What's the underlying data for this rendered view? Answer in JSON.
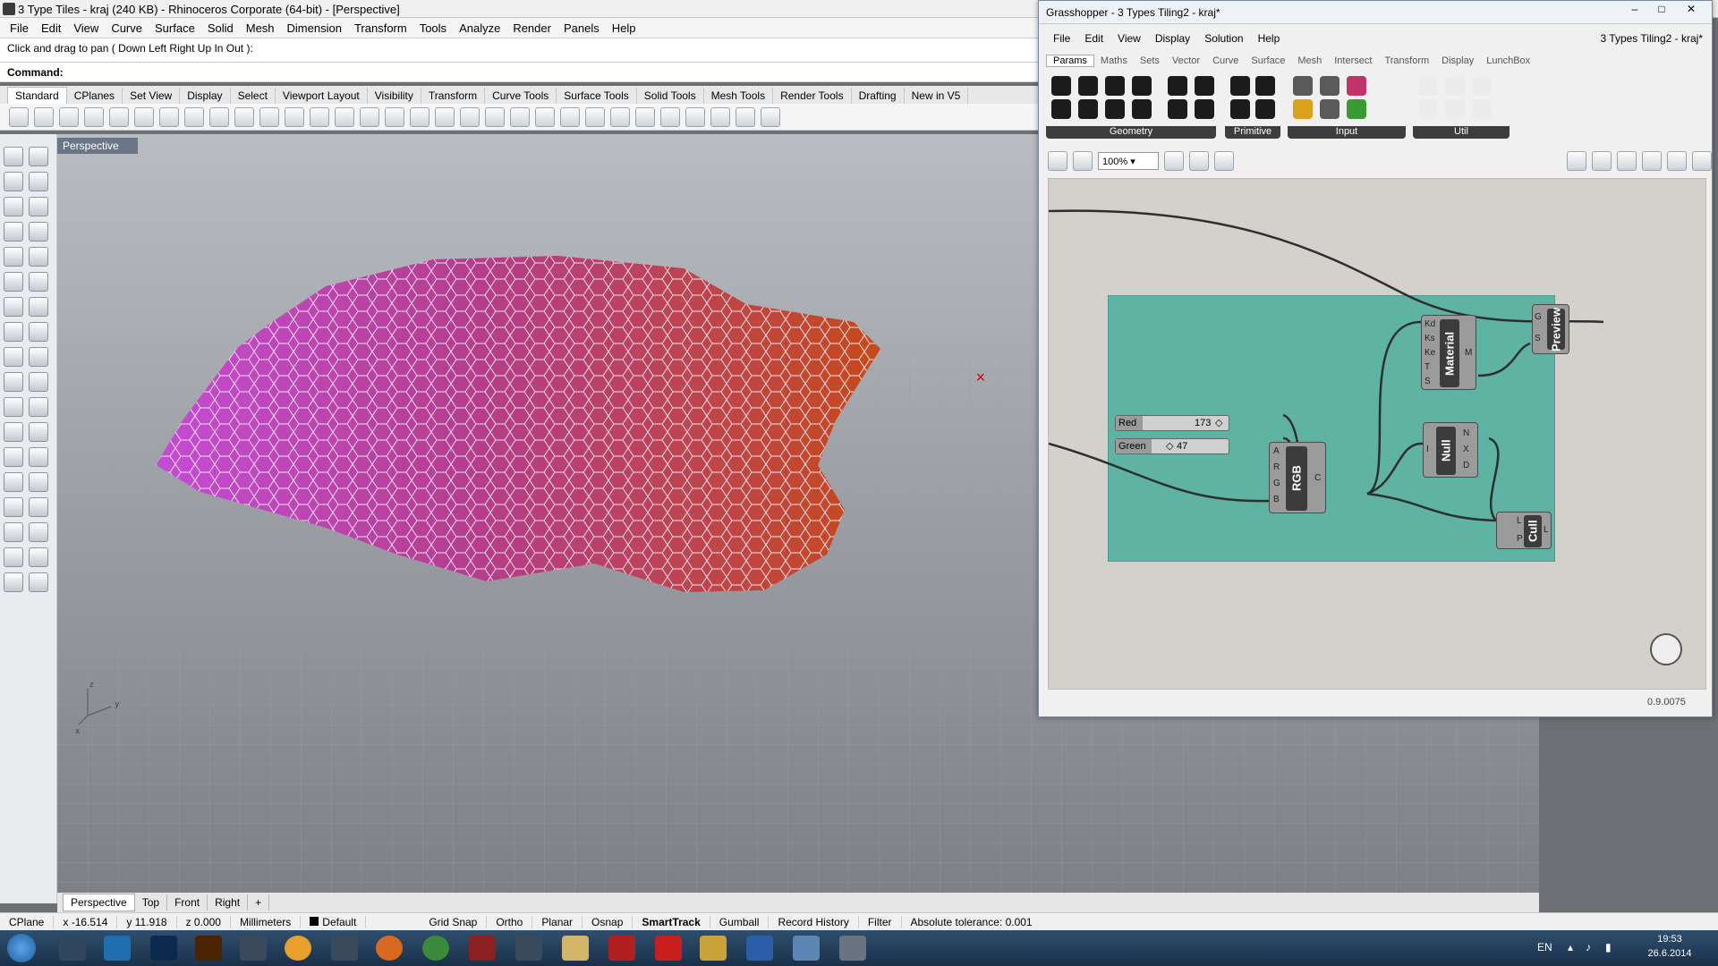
{
  "rhino": {
    "title": "3 Type Tiles - kraj (240 KB) - Rhinoceros Corporate (64-bit) - [Perspective]",
    "menu": [
      "File",
      "Edit",
      "View",
      "Curve",
      "Surface",
      "Solid",
      "Mesh",
      "Dimension",
      "Transform",
      "Tools",
      "Analyze",
      "Render",
      "Panels",
      "Help"
    ],
    "command_history": "Click and drag to pan ( Down  Left  Right  Up  In  Out ):",
    "command_prompt": "Command:",
    "toolbar_tabs": [
      "Standard",
      "CPlanes",
      "Set View",
      "Display",
      "Select",
      "Viewport Layout",
      "Visibility",
      "Transform",
      "Curve Tools",
      "Surface Tools",
      "Solid Tools",
      "Mesh Tools",
      "Render Tools",
      "Drafting",
      "New in V5"
    ],
    "viewport_title": "Perspective",
    "viewport_tabs": [
      "Perspective",
      "Top",
      "Front",
      "Right"
    ],
    "status": {
      "cplane": "CPlane",
      "x": "x -16.514",
      "y": "y 11.918",
      "z": "z 0.000",
      "units": "Millimeters",
      "layer": "Default",
      "grid_snap": "Grid Snap",
      "ortho": "Ortho",
      "planar": "Planar",
      "osnap": "Osnap",
      "smarttrack": "SmartTrack",
      "gumball": "Gumball",
      "record_history": "Record History",
      "filter": "Filter",
      "tolerance": "Absolute tolerance: 0.001"
    }
  },
  "grasshopper": {
    "title": "Grasshopper - 3 Types Tiling2 - kraj*",
    "doc_name": "3 Types Tiling2 - kraj*",
    "menu": [
      "File",
      "Edit",
      "View",
      "Display",
      "Solution",
      "Help"
    ],
    "tabs": [
      "Params",
      "Maths",
      "Sets",
      "Vector",
      "Curve",
      "Surface",
      "Mesh",
      "Intersect",
      "Transform",
      "Display",
      "LunchBox"
    ],
    "ribbon_groups": [
      "Geometry",
      "Primitive",
      "Input",
      "Util"
    ],
    "zoom": "100%",
    "version": "0.9.0075",
    "components": {
      "preview": {
        "label": "Preview",
        "inputs": [
          "G",
          "S"
        ]
      },
      "material": {
        "label": "Material",
        "inputs": [
          "Kd",
          "Ks",
          "Ke",
          "T",
          "S"
        ],
        "output": "M"
      },
      "rgb": {
        "label": "RGB",
        "inputs": [
          "A",
          "R",
          "G",
          "B"
        ],
        "output": "C"
      },
      "null": {
        "label": "Null",
        "input": "I",
        "outputs": [
          "N",
          "X",
          "D"
        ]
      },
      "cull": {
        "label": "Cull",
        "inputs": [
          "L",
          "P"
        ],
        "output": "L"
      }
    },
    "sliders": [
      {
        "name": "Red",
        "value": "173"
      },
      {
        "name": "Green",
        "value": "47"
      }
    ]
  },
  "taskbar": {
    "lang": "EN",
    "time": "19:53",
    "date": "26.6.2014"
  }
}
